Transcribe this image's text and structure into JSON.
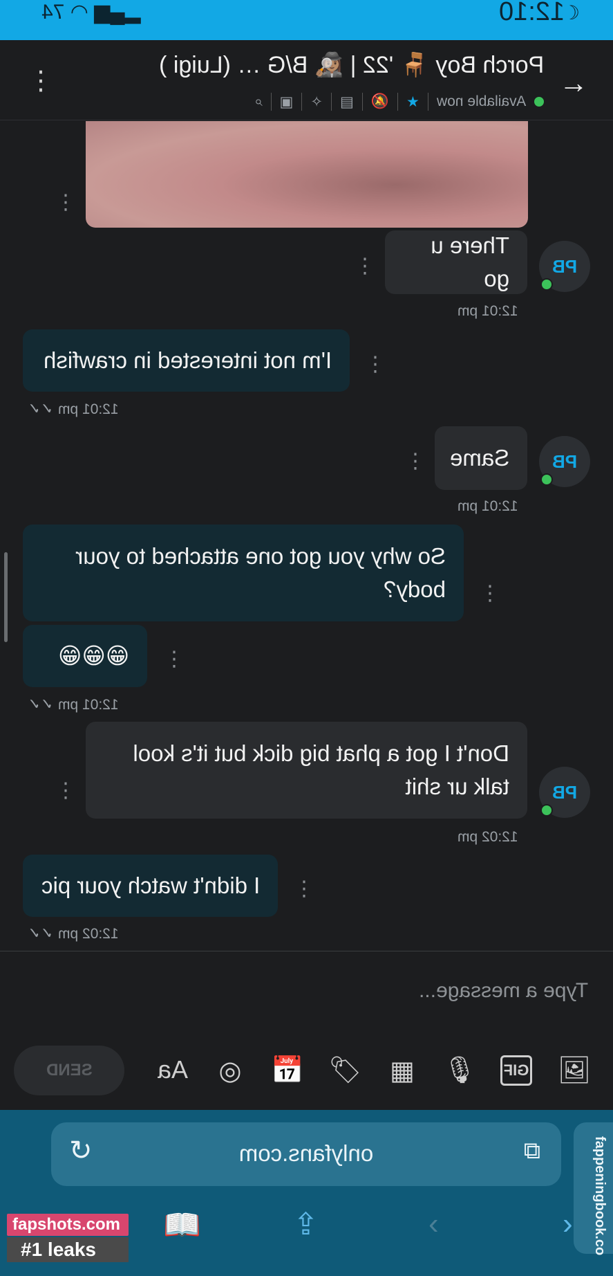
{
  "status_bar": {
    "time": "12:10",
    "battery": "74"
  },
  "header": {
    "title": "Porch Boy 🪑 '22 | 🕵🏽‍♀️ B/G … (Luigi )",
    "status": "Available now"
  },
  "messages": {
    "m1": {
      "text": "There u go",
      "time": "12:01 pm",
      "avatar": "PB"
    },
    "m2": {
      "text": "I'm not interested in crawfish",
      "time": "12:01 pm"
    },
    "m3": {
      "text": "Same",
      "time": "12:01 pm",
      "avatar": "PB"
    },
    "m4": {
      "text": "So why you got one attached to your body?",
      "emoji": "😁😁😁",
      "time": "12:01 pm"
    },
    "m5": {
      "text": "Don't I got a phat big dick but it's kool talk ur shit",
      "time": "12:02 pm",
      "avatar": "PB"
    },
    "m6": {
      "text": "I didn't watch your pic",
      "time": "12:02 pm"
    }
  },
  "composer": {
    "placeholder": "Type a message...",
    "send_label": "SEND",
    "format_label": "Aa",
    "gif_label": "GIF"
  },
  "browser": {
    "url": "onlyfans.com",
    "side_tab": "fappeningbook.co"
  },
  "watermark": {
    "top": "fapshots.com",
    "bottom": "#1 leaks"
  },
  "colors": {
    "accent": "#12a8e5",
    "online": "#3cc25a",
    "incoming_bubble": "#132a33",
    "outgoing_bubble": "#2a2c2f"
  }
}
